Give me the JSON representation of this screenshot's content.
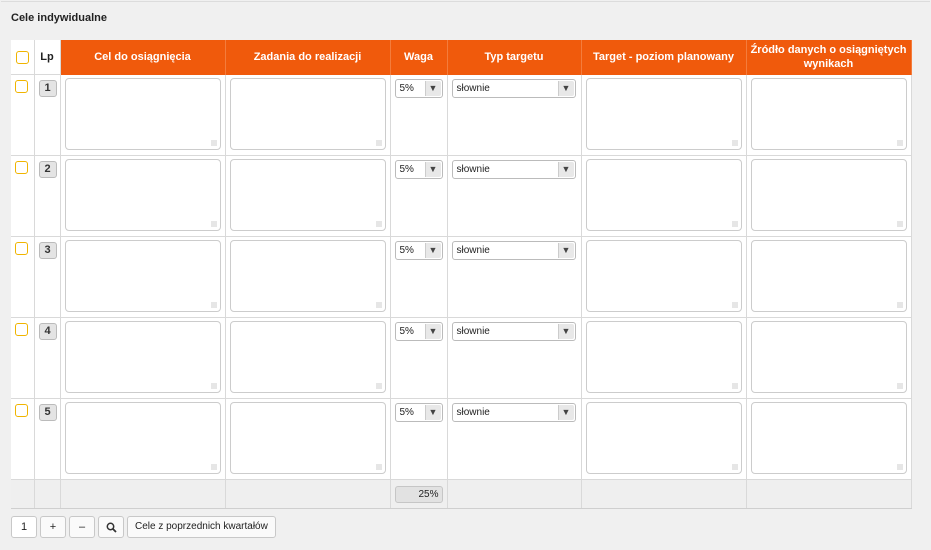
{
  "section": {
    "title": "Cele indywidualne"
  },
  "table": {
    "headers": {
      "lp": "Lp",
      "cel": "Cel do osiągnięcia",
      "zadania": "Zadania do realizacji",
      "waga": "Waga",
      "typ": "Typ targetu",
      "target": "Target - poziom planowany",
      "zrodlo": "Źródło danych o osiągniętych wynikach"
    },
    "rows": [
      {
        "lp": "1",
        "waga": "5%",
        "typ": "słownie"
      },
      {
        "lp": "2",
        "waga": "5%",
        "typ": "słownie"
      },
      {
        "lp": "3",
        "waga": "5%",
        "typ": "słownie"
      },
      {
        "lp": "4",
        "waga": "5%",
        "typ": "słownie"
      },
      {
        "lp": "5",
        "waga": "5%",
        "typ": "słownie"
      }
    ],
    "footer": {
      "waga_sum": "25%"
    }
  },
  "toolbar": {
    "page": "1",
    "add": "+",
    "remove": "–",
    "search_icon": "search-icon",
    "prev_quarters": "Cele z poprzednich kwartałów"
  },
  "colors": {
    "header": "#f05a0c",
    "checkbox_border": "#f0b400"
  }
}
